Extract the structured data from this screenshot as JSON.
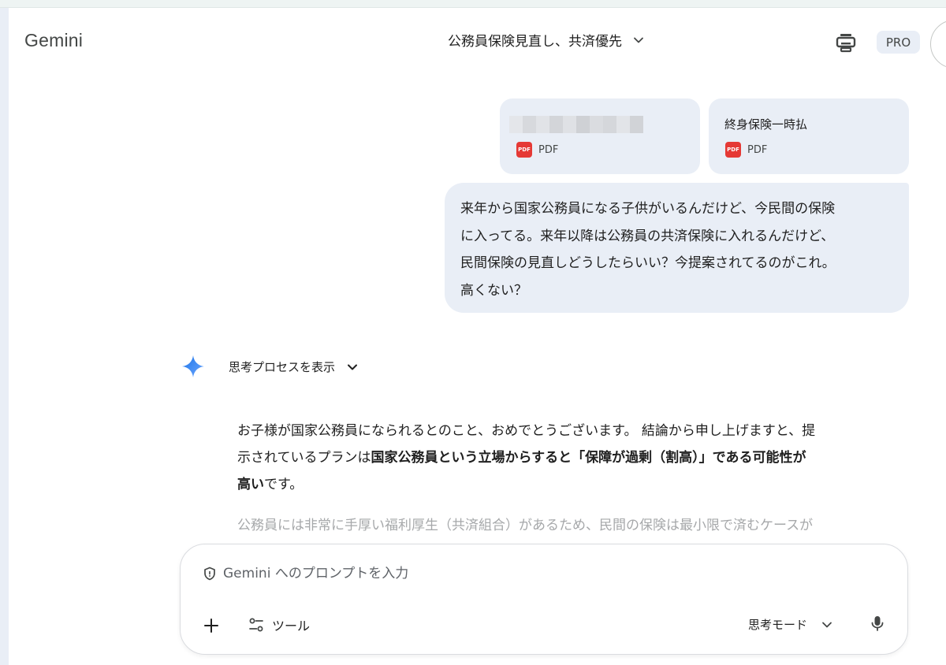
{
  "app": {
    "name": "Gemini"
  },
  "header": {
    "conversation_title": "公務員保険見直し、共済優先",
    "badge": "PRO"
  },
  "attachments": [
    {
      "name": "",
      "type": "PDF",
      "name_redacted": true
    },
    {
      "name": "終身保険一時払",
      "type": "PDF"
    }
  ],
  "user_message": {
    "lines": [
      "来年から国家公務員になる子供がいるんだけど、今民間の保険",
      "に入ってる。来年以降は公務員の共済保険に入れるんだけど、",
      "民間保険の見直しどうしたらいい？今提案されてるのがこれ。",
      "高くない？"
    ]
  },
  "assistant": {
    "thinking_toggle_label": "思考プロセスを表示",
    "answer": {
      "line1": "お子様が国家公務員になられるとのこと、おめでとうございます。 結論から申し上げますと、提",
      "line2_plain": "示されているプランは",
      "line2_bold": "国家公務員という立場からすると「保障が過剰（割高）」である可能性が",
      "line3_bold": "高い",
      "line3_plain": "です。",
      "faded_line": "公務員には非常に手厚い福利厚生（共済組合）があるため、民間の保険は最小限で済むケースが"
    }
  },
  "composer": {
    "placeholder": "Gemini へのプロンプトを入力",
    "tools_label": "ツール",
    "mode_label": "思考モード"
  },
  "icons": {
    "print": "print-icon",
    "chevron": "chevron-down-icon",
    "spark": "gemini-spark-icon",
    "shield": "shield-icon",
    "add": "plus-icon",
    "tools": "tools-icon",
    "mic": "microphone-icon"
  },
  "colors": {
    "bubble_bg": "#e9eef6",
    "pdf_red": "#e53935",
    "spark_blue": "#4285f4",
    "faded_text": "#a6a8aa"
  }
}
